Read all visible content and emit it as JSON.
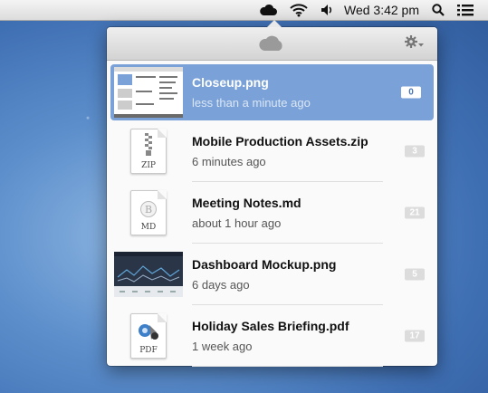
{
  "menubar": {
    "clock": "Wed 3:42 pm",
    "icons": [
      "cloud-icon",
      "wifi-icon",
      "volume-icon",
      "search-icon",
      "list-icon"
    ]
  },
  "popover": {
    "header_icon": "cloud-icon",
    "settings_icon": "gear-icon",
    "items": [
      {
        "name": "Closeup.png",
        "time": "less than a minute ago",
        "badge": "0",
        "thumb": "screenshot"
      },
      {
        "name": "Mobile Production Assets.zip",
        "time": "6 minutes ago",
        "badge": "3",
        "thumb": "zip",
        "ext": "ZIP"
      },
      {
        "name": "Meeting Notes.md",
        "time": "about 1 hour ago",
        "badge": "21",
        "thumb": "md",
        "ext": "MD"
      },
      {
        "name": "Dashboard Mockup.png",
        "time": "6 days ago",
        "badge": "5",
        "thumb": "dashboard"
      },
      {
        "name": "Holiday Sales Briefing.pdf",
        "time": "1 week ago",
        "badge": "17",
        "thumb": "pdf",
        "ext": "PDF"
      }
    ]
  },
  "colors": {
    "selected_row": "#7aa2d8",
    "badge_gray": "#dcdcdc"
  }
}
